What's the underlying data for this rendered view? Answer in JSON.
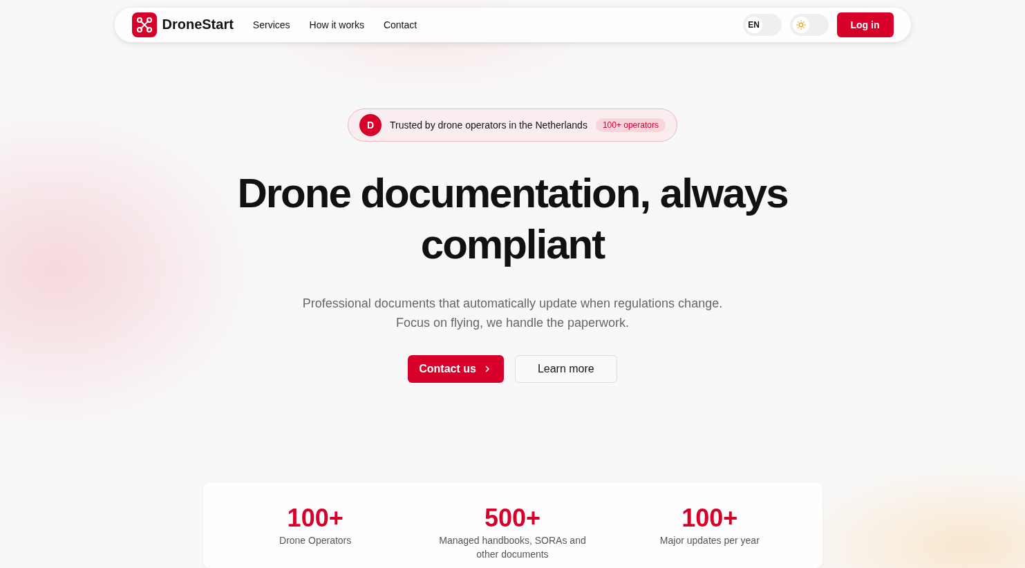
{
  "nav": {
    "brand": "DroneStart",
    "links": [
      "Services",
      "How it works",
      "Contact"
    ],
    "language": "EN",
    "theme_toggle": {
      "dark": false
    },
    "login": "Log in"
  },
  "hero": {
    "badge": {
      "avatar": "D",
      "text": "Trusted by drone operators in the Netherlands",
      "pill": "100+ operators"
    },
    "title": "Drone documentation, always compliant",
    "subtitle": [
      "Professional documents that automatically update when regulations change.",
      "Focus on flying, we handle the paperwork."
    ],
    "primary_button": "Contact us",
    "secondary_button": "Learn more"
  },
  "stats": [
    {
      "value": "100+",
      "label": "Drone Operators"
    },
    {
      "value": "500+",
      "label": "Managed handbooks, SORAs and other documents"
    },
    {
      "value": "100+",
      "label": "Major updates per year"
    }
  ]
}
